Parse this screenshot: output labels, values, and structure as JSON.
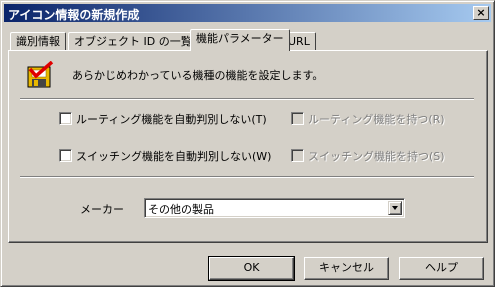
{
  "window": {
    "title": "アイコン情報の新規作成",
    "close_label": "×"
  },
  "tabs": [
    {
      "label": "識別情報",
      "active": false
    },
    {
      "label": "オブジェクト ID の一覧",
      "active": false
    },
    {
      "label": "機能パラメーター",
      "active": true
    },
    {
      "label": "URL",
      "active": false
    }
  ],
  "panel": {
    "icon": "checklist-floppy-icon",
    "description": "あらかじめわかっている機種の機能を設定します。",
    "options": [
      {
        "label": "ルーティング機能を自動判別しない(T)",
        "checked": false,
        "enabled": true
      },
      {
        "label": "ルーティング機能を持つ(R)",
        "checked": false,
        "enabled": false
      },
      {
        "label": "スイッチング機能を自動判別しない(W)",
        "checked": false,
        "enabled": true
      },
      {
        "label": "スイッチング機能を持つ(S)",
        "checked": false,
        "enabled": false
      }
    ],
    "maker": {
      "label": "メーカー",
      "selected": "その他の製品"
    }
  },
  "buttons": {
    "ok": "OK",
    "cancel": "キャンセル",
    "help": "ヘルプ"
  },
  "colors": {
    "title_start": "#0a246a",
    "title_end": "#a6caf0",
    "face": "#d4d0c8"
  }
}
